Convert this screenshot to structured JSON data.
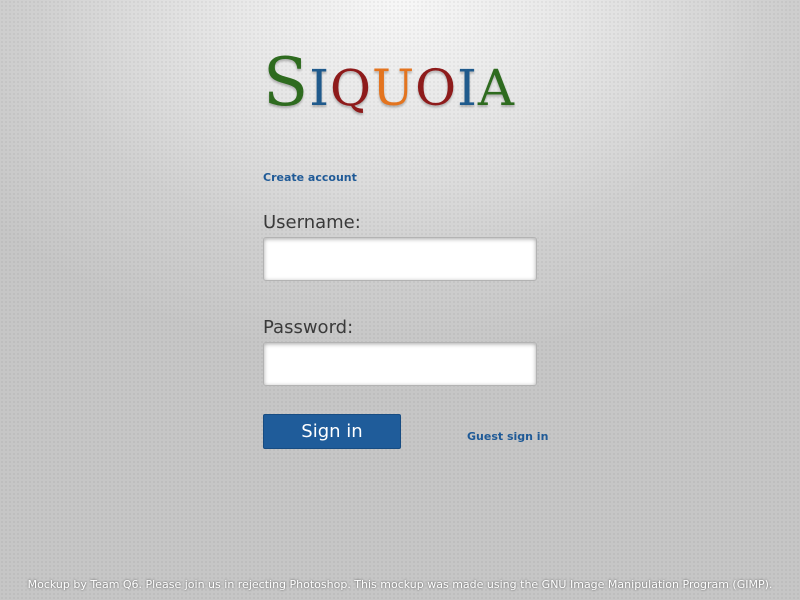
{
  "logo": {
    "letters": [
      {
        "char": "S",
        "color": "#2e6b1f",
        "size": "big"
      },
      {
        "char": "I",
        "color": "#1f5a8c",
        "size": "small"
      },
      {
        "char": "Q",
        "color": "#8e1b1b",
        "size": "small"
      },
      {
        "char": "U",
        "color": "#e3741f",
        "size": "small"
      },
      {
        "char": "O",
        "color": "#8e1b1b",
        "size": "small"
      },
      {
        "char": "I",
        "color": "#1f5a8c",
        "size": "small"
      },
      {
        "char": "A",
        "color": "#2e6b1f",
        "size": "small"
      }
    ]
  },
  "links": {
    "create_account": "Create account",
    "guest_sign_in": "Guest sign in"
  },
  "form": {
    "username_label": "Username:",
    "username_value": "",
    "password_label": "Password:",
    "password_value": "",
    "sign_in_label": "Sign in"
  },
  "footer": {
    "text": "Mockup by Team Q6. Please join us in rejecting Photoshop. This mockup was made using the GNU Image Manipulation Program (GIMP)."
  },
  "colors": {
    "link": "#1f5a97",
    "button": "#1f5c9a"
  }
}
